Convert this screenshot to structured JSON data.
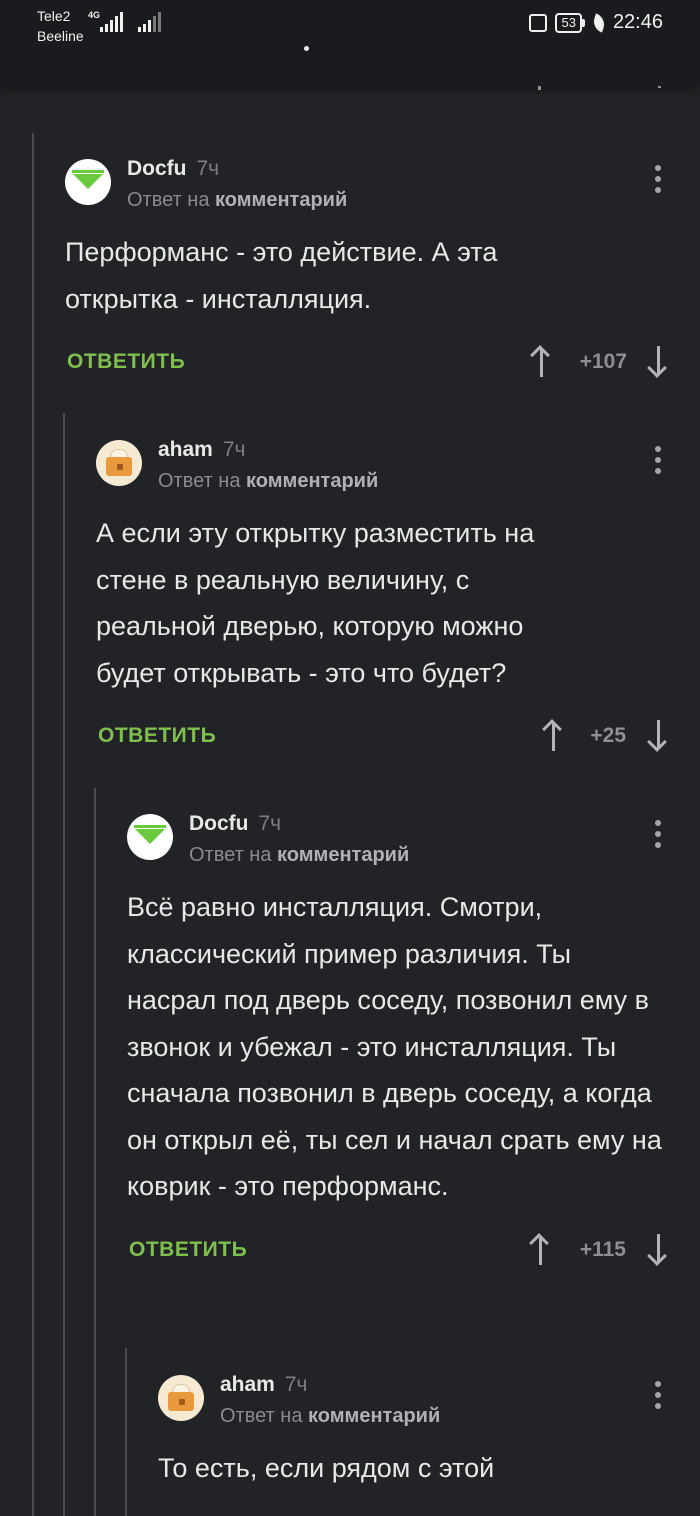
{
  "status_bar": {
    "carrier1": "Tele2",
    "carrier2": "Beeline",
    "network": "4G",
    "battery": "53",
    "time": "22:46"
  },
  "actions": {
    "reply_label": "ОТВЕТИТЬ"
  },
  "comments": [
    {
      "user": "Docfu",
      "time": "7ч",
      "reply_prefix": "Ответ на",
      "reply_target": "комментарий",
      "text": "Перформанс - это действие. А эта открытка - инсталляция.",
      "score": "+107",
      "avatar": "green-triangle-avatar"
    },
    {
      "user": "aham",
      "time": "7ч",
      "reply_prefix": "Ответ на",
      "reply_target": "комментарий",
      "text": "А если эту открытку разместить на стене в реальную величину, с реальной дверью, которую можно будет открывать - это что будет?",
      "score": "+25",
      "avatar": "cake-avatar"
    },
    {
      "user": "Docfu",
      "time": "7ч",
      "reply_prefix": "Ответ на",
      "reply_target": "комментарий",
      "text": "Всё равно инсталляция. Смотри, классический пример различия. Ты насрал под дверь соседу, позвонил ему в звонок и убежал - это инсталляция. Ты сначала позвонил в дверь соседу, а когда он открыл её, ты сел и начал срать ему на коврик - это перформанс.",
      "score": "+115",
      "avatar": "green-triangle-avatar"
    },
    {
      "user": "aham",
      "time": "7ч",
      "reply_prefix": "Ответ на",
      "reply_target": "комментарий",
      "text": "То есть, если рядом с этой",
      "avatar": "cake-avatar"
    }
  ],
  "colors": {
    "background": "#222326",
    "accent_reply": "#7fbf4e",
    "avatar_green": "#6bc93c"
  }
}
